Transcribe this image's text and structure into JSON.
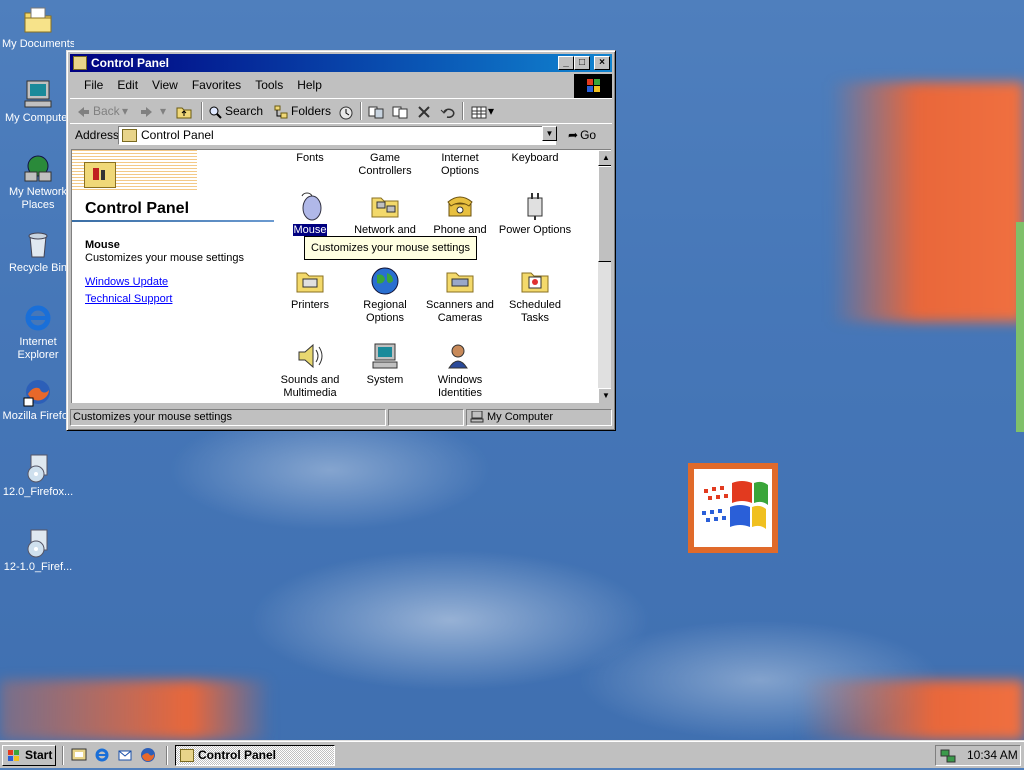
{
  "desktop": {
    "icons": [
      {
        "label": "My Documents"
      },
      {
        "label": "My Computer"
      },
      {
        "label": "My Network Places"
      },
      {
        "label": "Recycle Bin"
      },
      {
        "label": "Internet Explorer"
      },
      {
        "label": "Mozilla Firefox"
      },
      {
        "label": "12.0_Firefox..."
      },
      {
        "label": "12-1.0_Firef..."
      }
    ]
  },
  "window": {
    "title": "Control Panel",
    "menu": [
      "File",
      "Edit",
      "View",
      "Favorites",
      "Tools",
      "Help"
    ],
    "toolbar": {
      "back": "Back",
      "search": "Search",
      "folders": "Folders"
    },
    "address": {
      "label": "Address",
      "value": "Control Panel",
      "go": "Go"
    },
    "left_pane": {
      "title": "Control Panel",
      "selected_name": "Mouse",
      "selected_desc": "Customizes your mouse settings",
      "links": [
        "Windows Update",
        "Technical Support"
      ]
    },
    "items": [
      {
        "line1": "Fonts",
        "line2": ""
      },
      {
        "line1": "Game",
        "line2": "Controllers"
      },
      {
        "line1": "Internet",
        "line2": "Options"
      },
      {
        "line1": "Keyboard",
        "line2": ""
      },
      {
        "line1": "Mouse",
        "line2": ""
      },
      {
        "line1": "Network and",
        "line2": ""
      },
      {
        "line1": "Phone and",
        "line2": "..."
      },
      {
        "line1": "Power Options",
        "line2": ""
      },
      {
        "line1": "Printers",
        "line2": ""
      },
      {
        "line1": "Regional",
        "line2": "Options"
      },
      {
        "line1": "Scanners and",
        "line2": "Cameras"
      },
      {
        "line1": "Scheduled",
        "line2": "Tasks"
      },
      {
        "line1": "Sounds and",
        "line2": "Multimedia"
      },
      {
        "line1": "System",
        "line2": ""
      },
      {
        "line1": "Windows",
        "line2": "Identities"
      }
    ],
    "tooltip": "Customizes your mouse settings",
    "status": {
      "left": "Customizes your mouse settings",
      "zone": "My Computer"
    }
  },
  "taskbar": {
    "start": "Start",
    "task": "Control Panel",
    "clock": "10:34 AM"
  },
  "colors": {
    "titlebar_start": "#000080",
    "titlebar_end": "#1084d0",
    "selection": "#000080",
    "link": "#0000ff"
  }
}
